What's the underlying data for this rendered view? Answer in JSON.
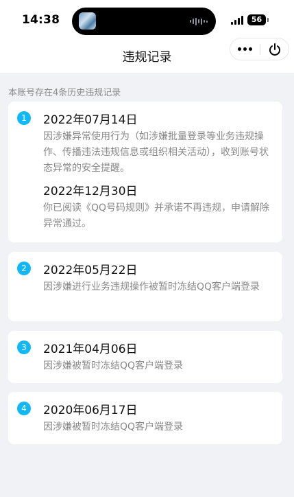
{
  "status_bar": {
    "time": "14:38",
    "battery": "56"
  },
  "nav": {
    "title": "违规记录"
  },
  "summary": "本账号存在4条历史违规记录",
  "records": [
    {
      "index": "1",
      "entries": [
        {
          "date": "2022年07月14日",
          "text": "因涉嫌异常使用行为（如涉嫌批量登录等业务违规操作、传播违法违规信息或组织相关活动），收到账号状态异常的安全提醒。"
        },
        {
          "date": "2022年12月30日",
          "text": "你已阅读《QQ号码规则》并承诺不再违规，申请解除异常通过。"
        }
      ]
    },
    {
      "index": "2",
      "entries": [
        {
          "date": "2022年05月22日",
          "text": "因涉嫌进行业务违规操作被暂时冻结QQ客户端登录"
        }
      ]
    },
    {
      "index": "3",
      "entries": [
        {
          "date": "2021年04月06日",
          "text": "因涉嫌被暂时冻结QQ客户端登录"
        }
      ]
    },
    {
      "index": "4",
      "entries": [
        {
          "date": "2020年06月17日",
          "text": "因涉嫌被暂时冻结QQ客户端登录"
        }
      ]
    }
  ],
  "icons": {
    "more": "more-dots-icon",
    "power": "power-icon",
    "signal": "signal-icon",
    "battery": "battery-icon"
  },
  "colors": {
    "accent": "#12b7f5",
    "background": "#f1f2f6"
  }
}
